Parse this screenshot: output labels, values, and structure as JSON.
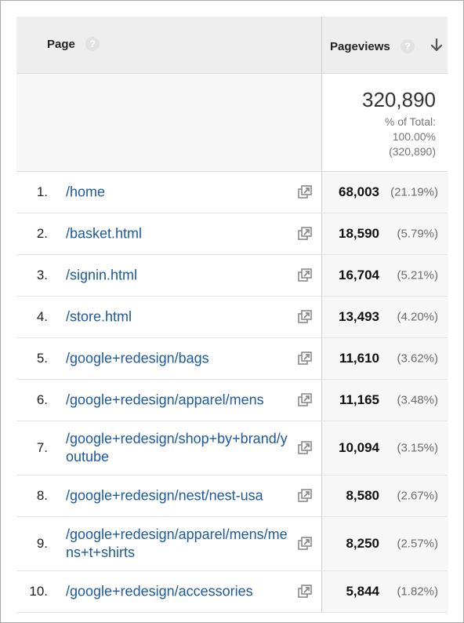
{
  "header": {
    "page_label": "Page",
    "pageviews_label": "Pageviews",
    "help_glyph": "?"
  },
  "totals": {
    "value": "320,890",
    "pct_label": "% of Total:",
    "pct_value": "100.00%",
    "pct_of": "(320,890)"
  },
  "rows": [
    {
      "rank": "1.",
      "page": "/home",
      "views": "68,003",
      "pct": "(21.19%)"
    },
    {
      "rank": "2.",
      "page": "/basket.html",
      "views": "18,590",
      "pct": "(5.79%)"
    },
    {
      "rank": "3.",
      "page": "/signin.html",
      "views": "16,704",
      "pct": "(5.21%)"
    },
    {
      "rank": "4.",
      "page": "/store.html",
      "views": "13,493",
      "pct": "(4.20%)"
    },
    {
      "rank": "5.",
      "page": "/google+redesign/bags",
      "views": "11,610",
      "pct": "(3.62%)"
    },
    {
      "rank": "6.",
      "page": "/google+redesign/apparel/mens",
      "views": "11,165",
      "pct": "(3.48%)"
    },
    {
      "rank": "7.",
      "page": "/google+redesign/shop+by+brand/youtube",
      "views": "10,094",
      "pct": "(3.15%)"
    },
    {
      "rank": "8.",
      "page": "/google+redesign/nest/nest-usa",
      "views": "8,580",
      "pct": "(2.67%)"
    },
    {
      "rank": "9.",
      "page": "/google+redesign/apparel/mens/mens+t+shirts",
      "views": "8,250",
      "pct": "(2.57%)"
    },
    {
      "rank": "10.",
      "page": "/google+redesign/accessories",
      "views": "5,844",
      "pct": "(1.82%)"
    }
  ],
  "icons": {
    "help": "question-circle-icon",
    "sort": "arrow-down-icon",
    "external": "open-in-new-window-icon"
  },
  "colors": {
    "link": "#1c5aa0",
    "header_bg": "#eeeeee",
    "metric_bg": "#f7f7f7"
  }
}
